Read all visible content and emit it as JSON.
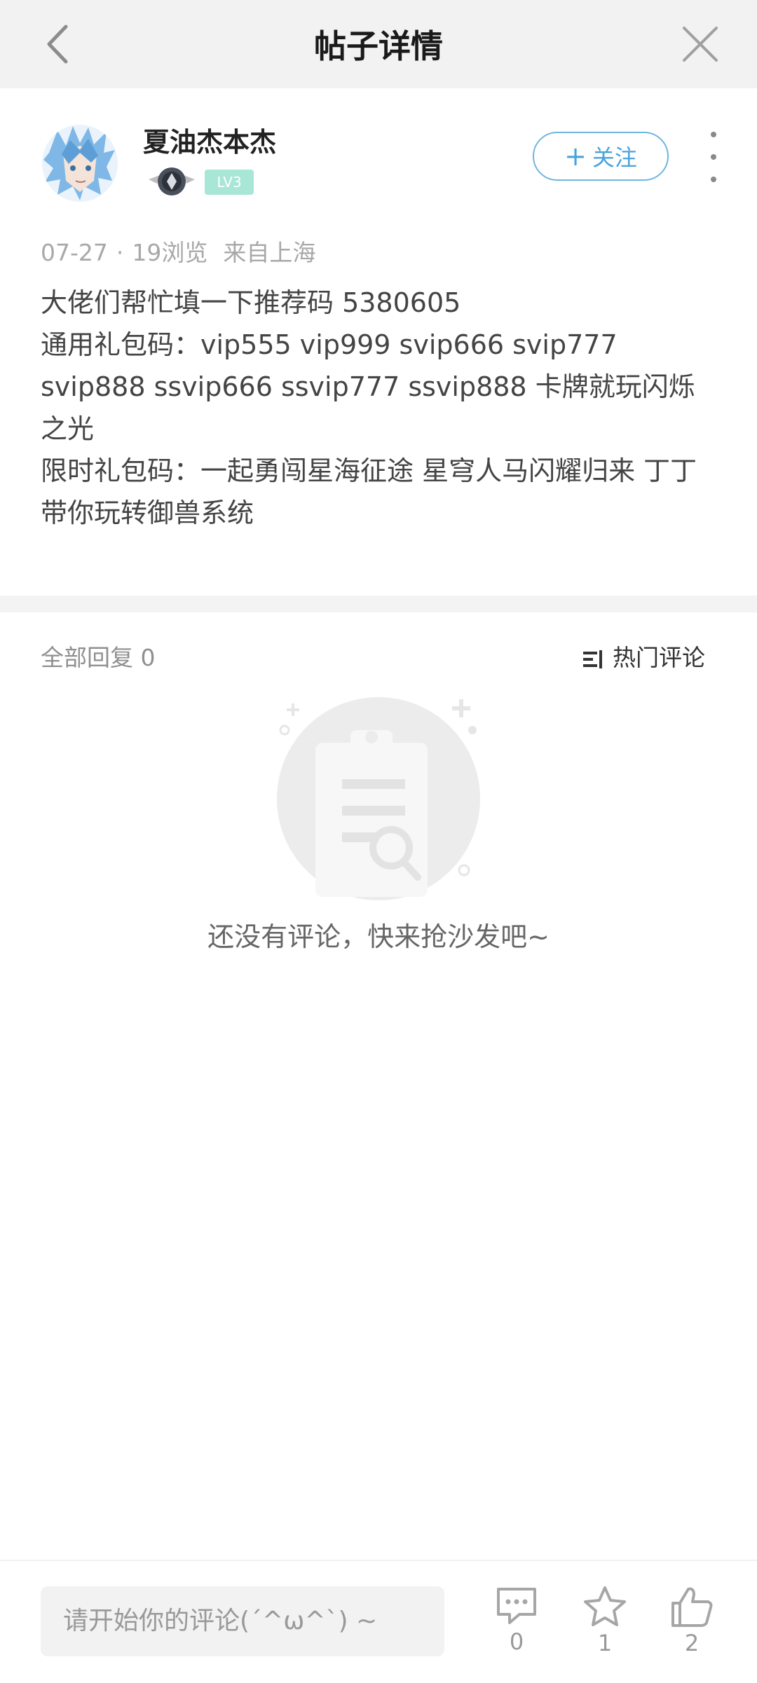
{
  "header": {
    "title": "帖子详情",
    "back_icon": "back-arrow-icon",
    "close_icon": "close-icon"
  },
  "author": {
    "name": "夏油杰本杰",
    "level": "LV3",
    "follow_label": "关注"
  },
  "meta": {
    "date": "07-27",
    "views": "19浏览",
    "location": "来自上海"
  },
  "post": {
    "lines": [
      "大佬们帮忙填一下推荐码 5380605",
      "通用礼包码：vip555  vip999  svip666  svip777  svip888  ssvip666  ssvip777  ssvip888  卡牌就玩闪烁之光",
      "限时礼包码：一起勇闯星海征途  星穹人马闪耀归来  丁丁带你玩转御兽系统"
    ]
  },
  "replies": {
    "label": "全部回复 0",
    "sort_label": "热门评论",
    "empty_text": "还没有评论，快来抢沙发吧~"
  },
  "bottom_bar": {
    "input_placeholder": "请开始你的评论(´^ω^`) ~",
    "comment_count": "0",
    "favorite_count": "1",
    "like_count": "2"
  },
  "colors": {
    "accent": "#4aa3dc",
    "level_badge": "#a8e6d6",
    "header_bg": "#f2f2f2"
  }
}
